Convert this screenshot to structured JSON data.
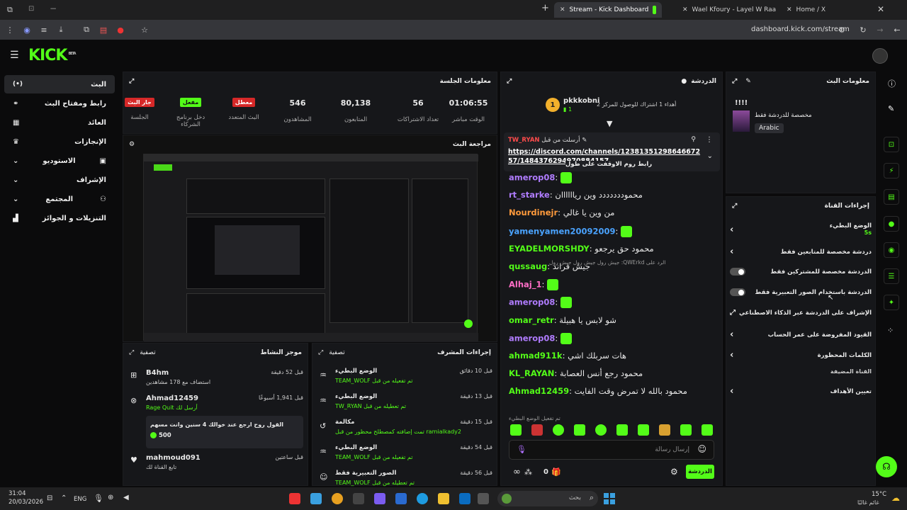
{
  "browser": {
    "tabs": [
      {
        "title": "Stream - Kick Dashboard",
        "active": true
      },
      {
        "title": "Wael Kfoury - Layel W Raad",
        "active": false
      },
      {
        "title": "Home / X",
        "active": false
      }
    ],
    "url": "dashboard.kick.com/stream"
  },
  "brand": {
    "logo": "KICK",
    "tag": "BETA",
    "accent": "#53fc18"
  },
  "nav": {
    "items": [
      {
        "label": "البث",
        "icon": "broadcast-icon"
      },
      {
        "label": "رابط ومفتاح البث",
        "icon": "link-icon"
      },
      {
        "label": "العائد",
        "icon": "revenue-icon"
      },
      {
        "label": "الإنجازات",
        "icon": "trophy-icon"
      },
      {
        "label": "الاستوديو",
        "icon": "studio-icon"
      },
      {
        "label": "الإشراف",
        "icon": "wrench-icon"
      },
      {
        "label": "المجتمع",
        "icon": "community-icon"
      },
      {
        "label": "التنزيلات و الجوائز",
        "icon": "gift-icon"
      }
    ]
  },
  "session": {
    "title": "معلومات الجلسة",
    "stats": [
      {
        "value": "01:06:55",
        "label": "الوقت مباشر"
      },
      {
        "value": "56",
        "label": "تعداد الاشتراكات"
      },
      {
        "value": "80,138",
        "label": "المتابعون"
      },
      {
        "value": "546",
        "label": "المشاهدون"
      },
      {
        "badge": "معطل",
        "label": "البث المتعدد"
      },
      {
        "badge": "مفعل",
        "label": "دخل برنامج الشركاء"
      },
      {
        "badge": "جار البث",
        "label": "الجلسة"
      }
    ]
  },
  "preview": {
    "title": "مراجعة البث"
  },
  "activity": {
    "title": "موجز النشاط",
    "filter": "تصفية",
    "rows": [
      {
        "name": "B4hm",
        "desc": "استضاف مع 178 مشاهدين",
        "time": "قبل 52 دقيقة"
      },
      {
        "name": "Ahmad12459",
        "desc": "أرسل لك Rage Quit",
        "time": "قبل 1,941 أسبوعًا",
        "msg": "القول روح ارجع عند خوالك 4 سنين وانت مسهم",
        "amount": "500"
      },
      {
        "name": "mahmoud091",
        "desc": "تابع القناة لك",
        "time": "قبل ساعتين"
      }
    ]
  },
  "modactions": {
    "title": "إجراءات المشرف",
    "filter": "تصفية",
    "rows": [
      {
        "title": "الوضع البطيء",
        "desc": "تم تفعيله من قبل TEAM_WOLF",
        "time": "قبل 10 دقائق"
      },
      {
        "title": "الوضع البطيء",
        "desc": "تم تعطيله من قبل TW_RYAN",
        "time": "قبل 13 دقيقة"
      },
      {
        "title": "مكالمة",
        "desc": "ramialkady2 تمت إضافته كمصطلح محظور من قبل",
        "time": "قبل 15 دقيقة"
      },
      {
        "title": "الوضع البطيء",
        "desc": "تم تفعيله من قبل TEAM_WOLF",
        "time": "قبل 54 دقيقة"
      },
      {
        "title": "الصور التعبيرية فقط",
        "desc": "تم تعطيله من قبل TEAM_WOLF",
        "time": "قبل 56 دقيقة"
      }
    ]
  },
  "chat": {
    "title": "الدردشة",
    "top_gifter": {
      "name": "pkkkobni",
      "count": "1",
      "text": "أهداء 1 اشتراك للوصول للمركز 2"
    },
    "pinned": {
      "by": "TW_RYAN",
      "by_label": "أرسلت من قبل",
      "link": "https://discord.com/channels/1238135129864667257/1484376294970884157",
      "text": "رابط روم الاوقفت على طول"
    },
    "messages": [
      {
        "user": "amerop08",
        "text": "",
        "color": "#b07cff",
        "emote": true
      },
      {
        "user": "rt_starke",
        "text": "محموددددددد وين رياااااان",
        "color": "#b07cff"
      },
      {
        "user": "Nourdinejr",
        "text": "من وين يا غالي",
        "color": "#ff9a3c"
      },
      {
        "user": "yamenyamen20092009",
        "text": "",
        "color": "#4aa3ff",
        "emote": true
      },
      {
        "user": "EYADELMORSHDY",
        "text": "محمود حق يرجعو",
        "color": "#53fc18"
      },
      {
        "user": "qussaug",
        "text": "جيش فراند",
        "color": "#53fc18"
      },
      {
        "user": "Alhaj_1",
        "text": "",
        "color": "#ff6ec7",
        "emote": true
      },
      {
        "user": "amerop08",
        "text": "",
        "color": "#b07cff",
        "emote": true
      },
      {
        "user": "omar_retr",
        "text": "شو لابس يا هبيلة",
        "color": "#53fc18"
      },
      {
        "user": "amerop08",
        "text": "",
        "color": "#b07cff",
        "emote": true
      },
      {
        "user": "ahmad911k",
        "text": "هات سربلك اشي",
        "color": "#53fc18"
      },
      {
        "user": "KL_RAYAN",
        "text": "محمود رجع أنس العصابة",
        "color": "#53fc18"
      },
      {
        "user": "Ahmad12459",
        "text": "محمود بالله لا تمرض وقت الفايت",
        "color": "#53fc18"
      }
    ],
    "reply_note": "الرد على QWErkd: جيش رول جيش رول جيش رول",
    "slow_mode_note": "تم تفعيل الوضع البطيء",
    "input_placeholder": "إرسال رسالة",
    "send_label": "الدردشة",
    "count": "0"
  },
  "streaminfo": {
    "title": "معلومات البث",
    "stream_title": "!!!!",
    "category": "مخصصة للدردشة فقط",
    "language": "Arabic"
  },
  "channelactions": {
    "title": "إجراءات القناة",
    "rows": [
      {
        "label": "الوضع البطيء",
        "sub": "5s",
        "type": "chevron"
      },
      {
        "label": "دردشة مخصصة للمتابعين فقط",
        "type": "chevron"
      },
      {
        "label": "الدردشة مخصصة للمشتركين فقط",
        "type": "toggle"
      },
      {
        "label": "الدردشة باستخدام الصور التعبيرية فقط",
        "type": "toggle"
      },
      {
        "label": "الإشراف على الدردشة عبر الذكاء الاصطناعي",
        "type": "external"
      },
      {
        "label": "القيود المفروضة على عمر الحساب",
        "type": "chevron"
      },
      {
        "label": "الكلمات المحظورة",
        "type": "chevron"
      }
    ],
    "section": "القناة المضيفة",
    "goals": "تعيين الأهداف"
  },
  "taskbar": {
    "time": "31:04",
    "date": "20/03/2026",
    "lang": "ENG",
    "search": "بحث",
    "weather_temp": "15°C",
    "weather_desc": "غائم غالبًا"
  }
}
